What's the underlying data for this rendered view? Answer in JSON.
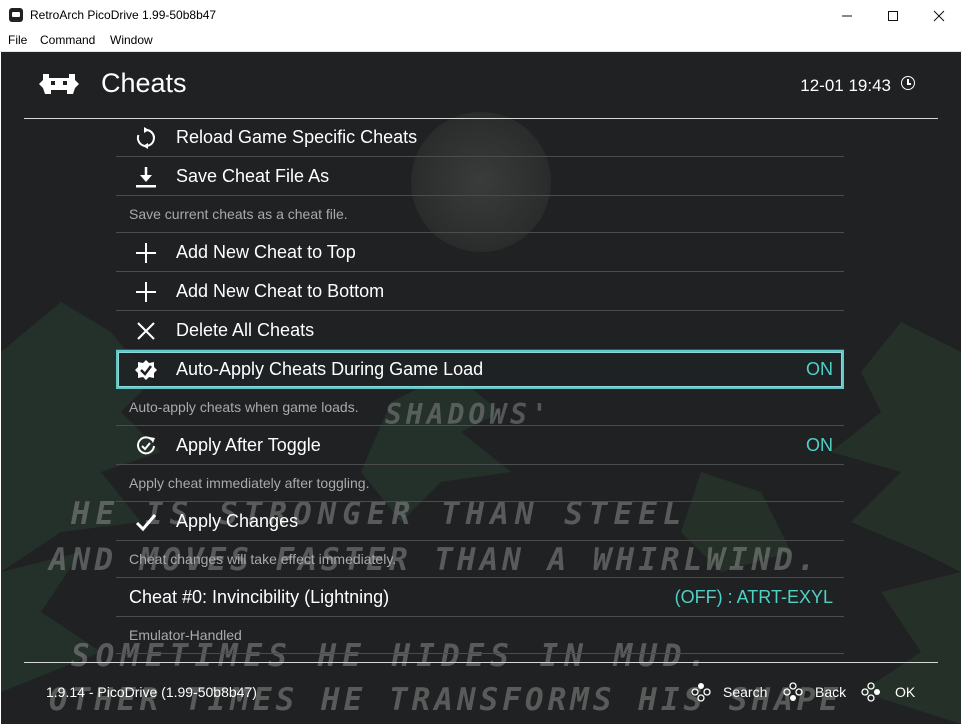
{
  "window": {
    "title": "RetroArch PicoDrive 1.99-50b8b47",
    "controls": {
      "minimize": "—",
      "maximize": "☐",
      "close": "✕"
    }
  },
  "menubar": {
    "items": [
      "File",
      "Command",
      "Window"
    ]
  },
  "header": {
    "title": "Cheats",
    "clock": "12-01 19:43"
  },
  "menu": [
    {
      "type": "item",
      "icon": "reload-icon",
      "label": "Reload Game Specific Cheats",
      "value": ""
    },
    {
      "type": "item",
      "icon": "download-icon",
      "label": "Save Cheat File As",
      "value": ""
    },
    {
      "type": "desc",
      "text": "Save current cheats as a cheat file."
    },
    {
      "type": "item",
      "icon": "plus-icon",
      "label": "Add New Cheat to Top",
      "value": ""
    },
    {
      "type": "item",
      "icon": "plus-icon",
      "label": "Add New Cheat to Bottom",
      "value": ""
    },
    {
      "type": "item",
      "icon": "close-icon",
      "label": "Delete All Cheats",
      "value": ""
    },
    {
      "type": "item",
      "icon": "badge-check-icon",
      "label": "Auto-Apply Cheats During Game Load",
      "value": "ON",
      "selected": true
    },
    {
      "type": "desc",
      "text": "Auto-apply cheats when game loads."
    },
    {
      "type": "item",
      "icon": "toggle-refresh-icon",
      "label": "Apply After Toggle",
      "value": "ON"
    },
    {
      "type": "desc",
      "text": "Apply cheat immediately after toggling."
    },
    {
      "type": "item",
      "icon": "checkmark-icon",
      "label": "Apply Changes",
      "value": ""
    },
    {
      "type": "desc",
      "text": "Cheat changes will take effect immediately."
    },
    {
      "type": "item",
      "icon": "",
      "label": "Cheat #0: Invincibility (Lightning)",
      "value": "(OFF) : ATRT-EXYL"
    },
    {
      "type": "desc",
      "text": "Emulator-Handled"
    }
  ],
  "background_text": [
    "SHADOWS'",
    "HE IS STRONGER THAN STEEL",
    "AND MOVES FASTER THAN A WHIRLWIND.",
    "SOMETIMES HE HIDES IN MUD.",
    "OTHER TIMES HE TRANSFORMS HIS SHAPE"
  ],
  "footer": {
    "version": "1.9.14 - PicoDrive (1.99-50b8b47)",
    "help": [
      {
        "icon": "gamepad-search-icon",
        "label": "Search"
      },
      {
        "icon": "gamepad-back-icon",
        "label": "Back"
      },
      {
        "icon": "gamepad-ok-icon",
        "label": "OK"
      }
    ]
  },
  "colors": {
    "accent": "#4fd1c5",
    "background": "#1e2021",
    "selection_border": "#5fc8c8"
  }
}
